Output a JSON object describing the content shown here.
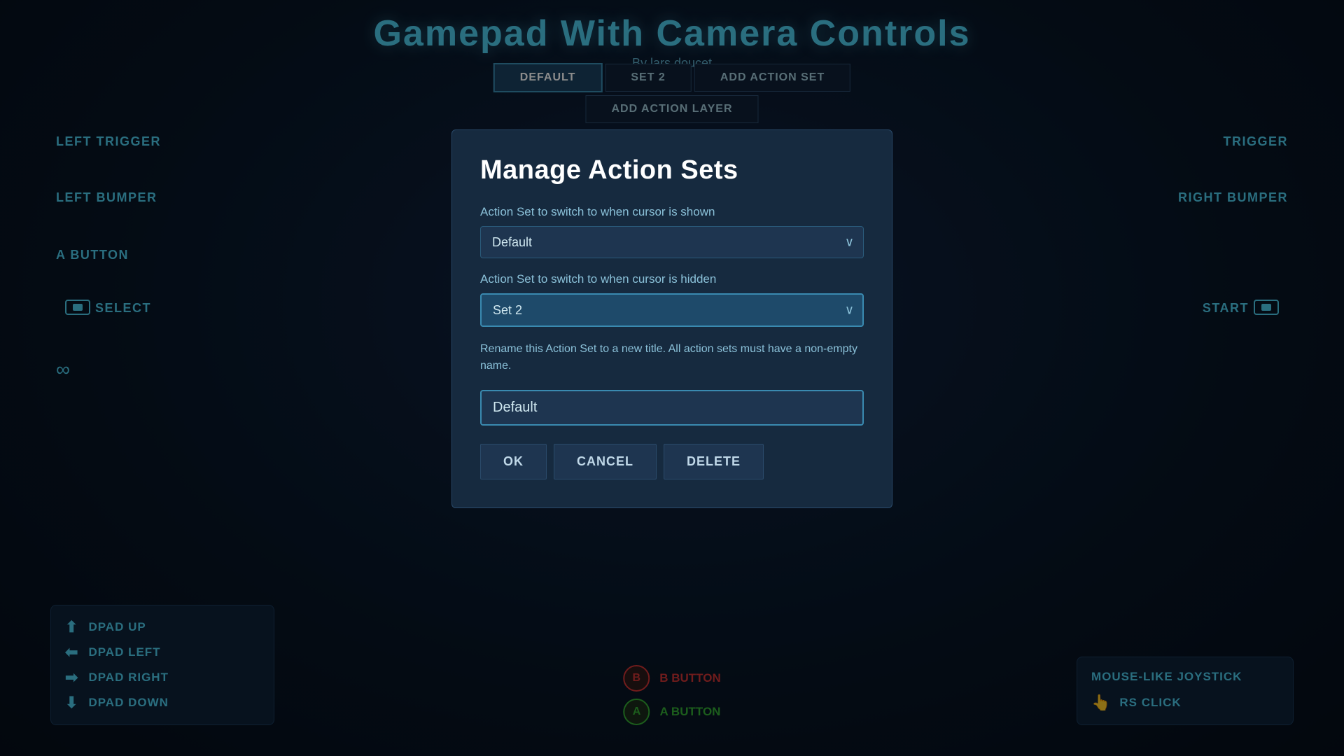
{
  "header": {
    "title": "Gamepad With Camera Controls",
    "subtitle": "By lars.doucet"
  },
  "tabs": {
    "default_label": "DEFAULT",
    "set2_label": "SET 2",
    "add_action_set_label": "ADD ACTION SET",
    "add_action_layer_label": "ADD ACTION LAYER"
  },
  "side_labels": {
    "left_trigger": "LEFT TRIGGER",
    "left_bumper": "LEFT BUMPER",
    "a_button": "A BUTTON",
    "select": "SELECT",
    "start": "START",
    "right_bumper": "RIGHT BUMPER",
    "right_trigger": "TRIGGER"
  },
  "dpad": {
    "up": "DPAD UP",
    "left": "DPAD LEFT",
    "right": "DPAD RIGHT",
    "down": "DPAD DOWN"
  },
  "joystick": {
    "title": "MOUSE-LIKE JOYSTICK",
    "rs_click": "RS CLICK"
  },
  "bottom_buttons": {
    "b_label": "B BUTTON",
    "a_label": "A BUTTON"
  },
  "modal": {
    "title": "Manage Action Sets",
    "cursor_shown_label": "Action Set to switch to when cursor is shown",
    "cursor_shown_value": "Default",
    "cursor_hidden_label": "Action Set to switch to when cursor is hidden",
    "cursor_hidden_value": "Set 2",
    "rename_note": "Rename this Action Set to a new title. All action sets must have a non-empty name.",
    "input_value": "Default",
    "ok_label": "OK",
    "cancel_label": "CANCEL",
    "delete_label": "DELETE"
  }
}
